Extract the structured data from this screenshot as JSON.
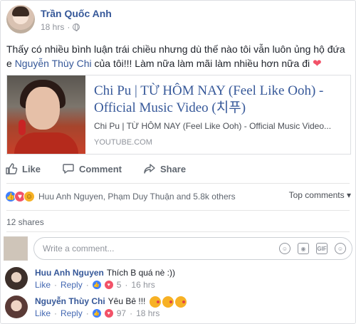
{
  "post": {
    "author": "Trần Quốc Anh",
    "time": "18 hrs",
    "text_before": "Thấy có nhiều bình luận trái chiều nhưng dù thế nào tôi vẫn luôn ủng hộ đứa e ",
    "mention": "Nguyễn Thùy Chi",
    "text_after": " của tôi!!! Làm nữa làm mãi làm nhiều hơn nữa đi ",
    "heart": "❤"
  },
  "link": {
    "title": "Chi Pu | TỪ HÔM NAY (Feel Like Ooh) - Official Music Video (치푸)",
    "description": "Chi Pu | TỪ HÔM NAY (Feel Like Ooh) - Official Music Video...",
    "domain": "YOUTUBE.COM"
  },
  "actions": {
    "like": "Like",
    "comment": "Comment",
    "share": "Share"
  },
  "reactions": {
    "summary": "Huu Anh Nguyen, Phạm Duy Thuận and 5.8k others",
    "top_comments": "Top comments ▾"
  },
  "shares": "12 shares",
  "compose": {
    "placeholder": "Write a comment..."
  },
  "comments": [
    {
      "name": "Huu Anh Nguyen",
      "text": "Thích B quá nè :))",
      "like": "Like",
      "reply": "Reply",
      "reactions": "5",
      "time": "16 hrs"
    },
    {
      "name": "Nguyễn Thùy Chi",
      "text": "Yêu Bê !!!",
      "like": "Like",
      "reply": "Reply",
      "reactions": "97",
      "time": "18 hrs"
    }
  ],
  "colors": {
    "link_blue": "#365899",
    "secondary": "#90949c",
    "like_blue": "#4080ff",
    "love_red": "#f25268"
  }
}
